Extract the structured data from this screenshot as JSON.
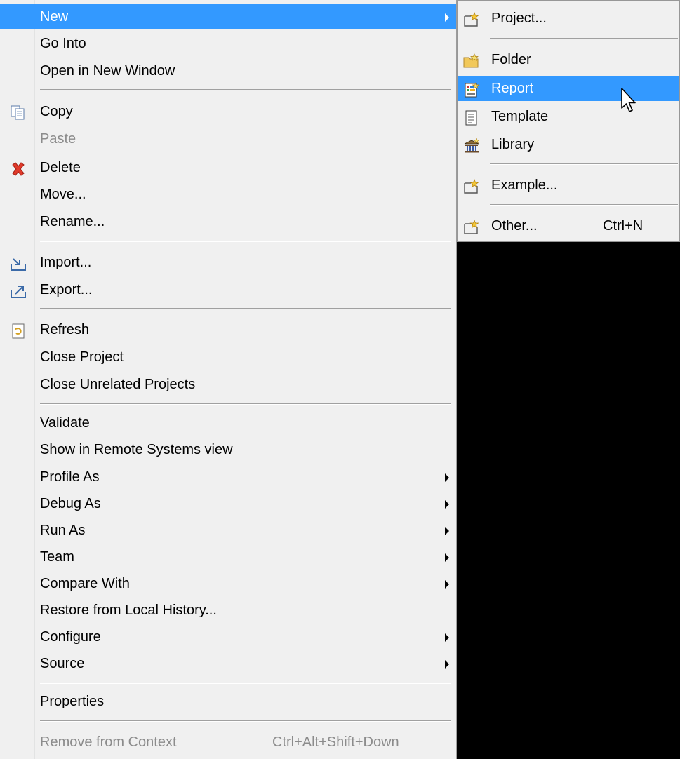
{
  "context_menu": {
    "items": [
      {
        "label": "New",
        "icon": "",
        "highlighted": true,
        "submenu": true
      },
      {
        "label": "Go Into",
        "icon": ""
      },
      {
        "label": "Open in New Window",
        "icon": ""
      },
      {
        "separator": true
      },
      {
        "label": "Copy",
        "icon": "copy-icon"
      },
      {
        "label": "Paste",
        "icon": "",
        "disabled": true
      },
      {
        "label": "Delete",
        "icon": "delete-icon"
      },
      {
        "label": "Move...",
        "icon": ""
      },
      {
        "label": "Rename...",
        "icon": ""
      },
      {
        "separator": true
      },
      {
        "label": "Import...",
        "icon": "import-icon"
      },
      {
        "label": "Export...",
        "icon": "export-icon"
      },
      {
        "separator": true
      },
      {
        "label": "Refresh",
        "icon": "refresh-icon"
      },
      {
        "label": "Close Project",
        "icon": ""
      },
      {
        "label": "Close Unrelated Projects",
        "icon": ""
      },
      {
        "separator": true
      },
      {
        "label": "Validate",
        "icon": ""
      },
      {
        "label": "Show in Remote Systems view",
        "icon": ""
      },
      {
        "label": "Profile As",
        "icon": "",
        "submenu": true
      },
      {
        "label": "Debug As",
        "icon": "",
        "submenu": true
      },
      {
        "label": "Run As",
        "icon": "",
        "submenu": true
      },
      {
        "label": "Team",
        "icon": "",
        "submenu": true
      },
      {
        "label": "Compare With",
        "icon": "",
        "submenu": true
      },
      {
        "label": "Restore from Local History...",
        "icon": ""
      },
      {
        "label": "Configure",
        "icon": "",
        "submenu": true
      },
      {
        "label": "Source",
        "icon": "",
        "submenu": true
      },
      {
        "separator": true
      },
      {
        "label": "Properties",
        "icon": ""
      },
      {
        "separator": true
      },
      {
        "label": "Remove from Context",
        "icon": "",
        "disabled": true,
        "shortcut": "Ctrl+Alt+Shift+Down"
      }
    ]
  },
  "new_submenu": {
    "items": [
      {
        "label": "Project...",
        "icon": "new-project-icon"
      },
      {
        "separator": true
      },
      {
        "label": "Folder",
        "icon": "folder-icon"
      },
      {
        "label": "Report",
        "icon": "report-icon",
        "highlighted": true
      },
      {
        "label": "Template",
        "icon": "template-icon"
      },
      {
        "label": "Library",
        "icon": "library-icon"
      },
      {
        "separator": true
      },
      {
        "label": "Example...",
        "icon": "new-example-icon"
      },
      {
        "separator": true
      },
      {
        "label": "Other...",
        "icon": "new-other-icon",
        "shortcut": "Ctrl+N"
      }
    ]
  },
  "colors": {
    "menu_background": "#f0f0f0",
    "highlight": "#3399ff",
    "disabled_text": "#8c8c8c",
    "desktop_background": "#000000"
  },
  "pointer": {
    "icon": "mouse-pointer-icon"
  }
}
